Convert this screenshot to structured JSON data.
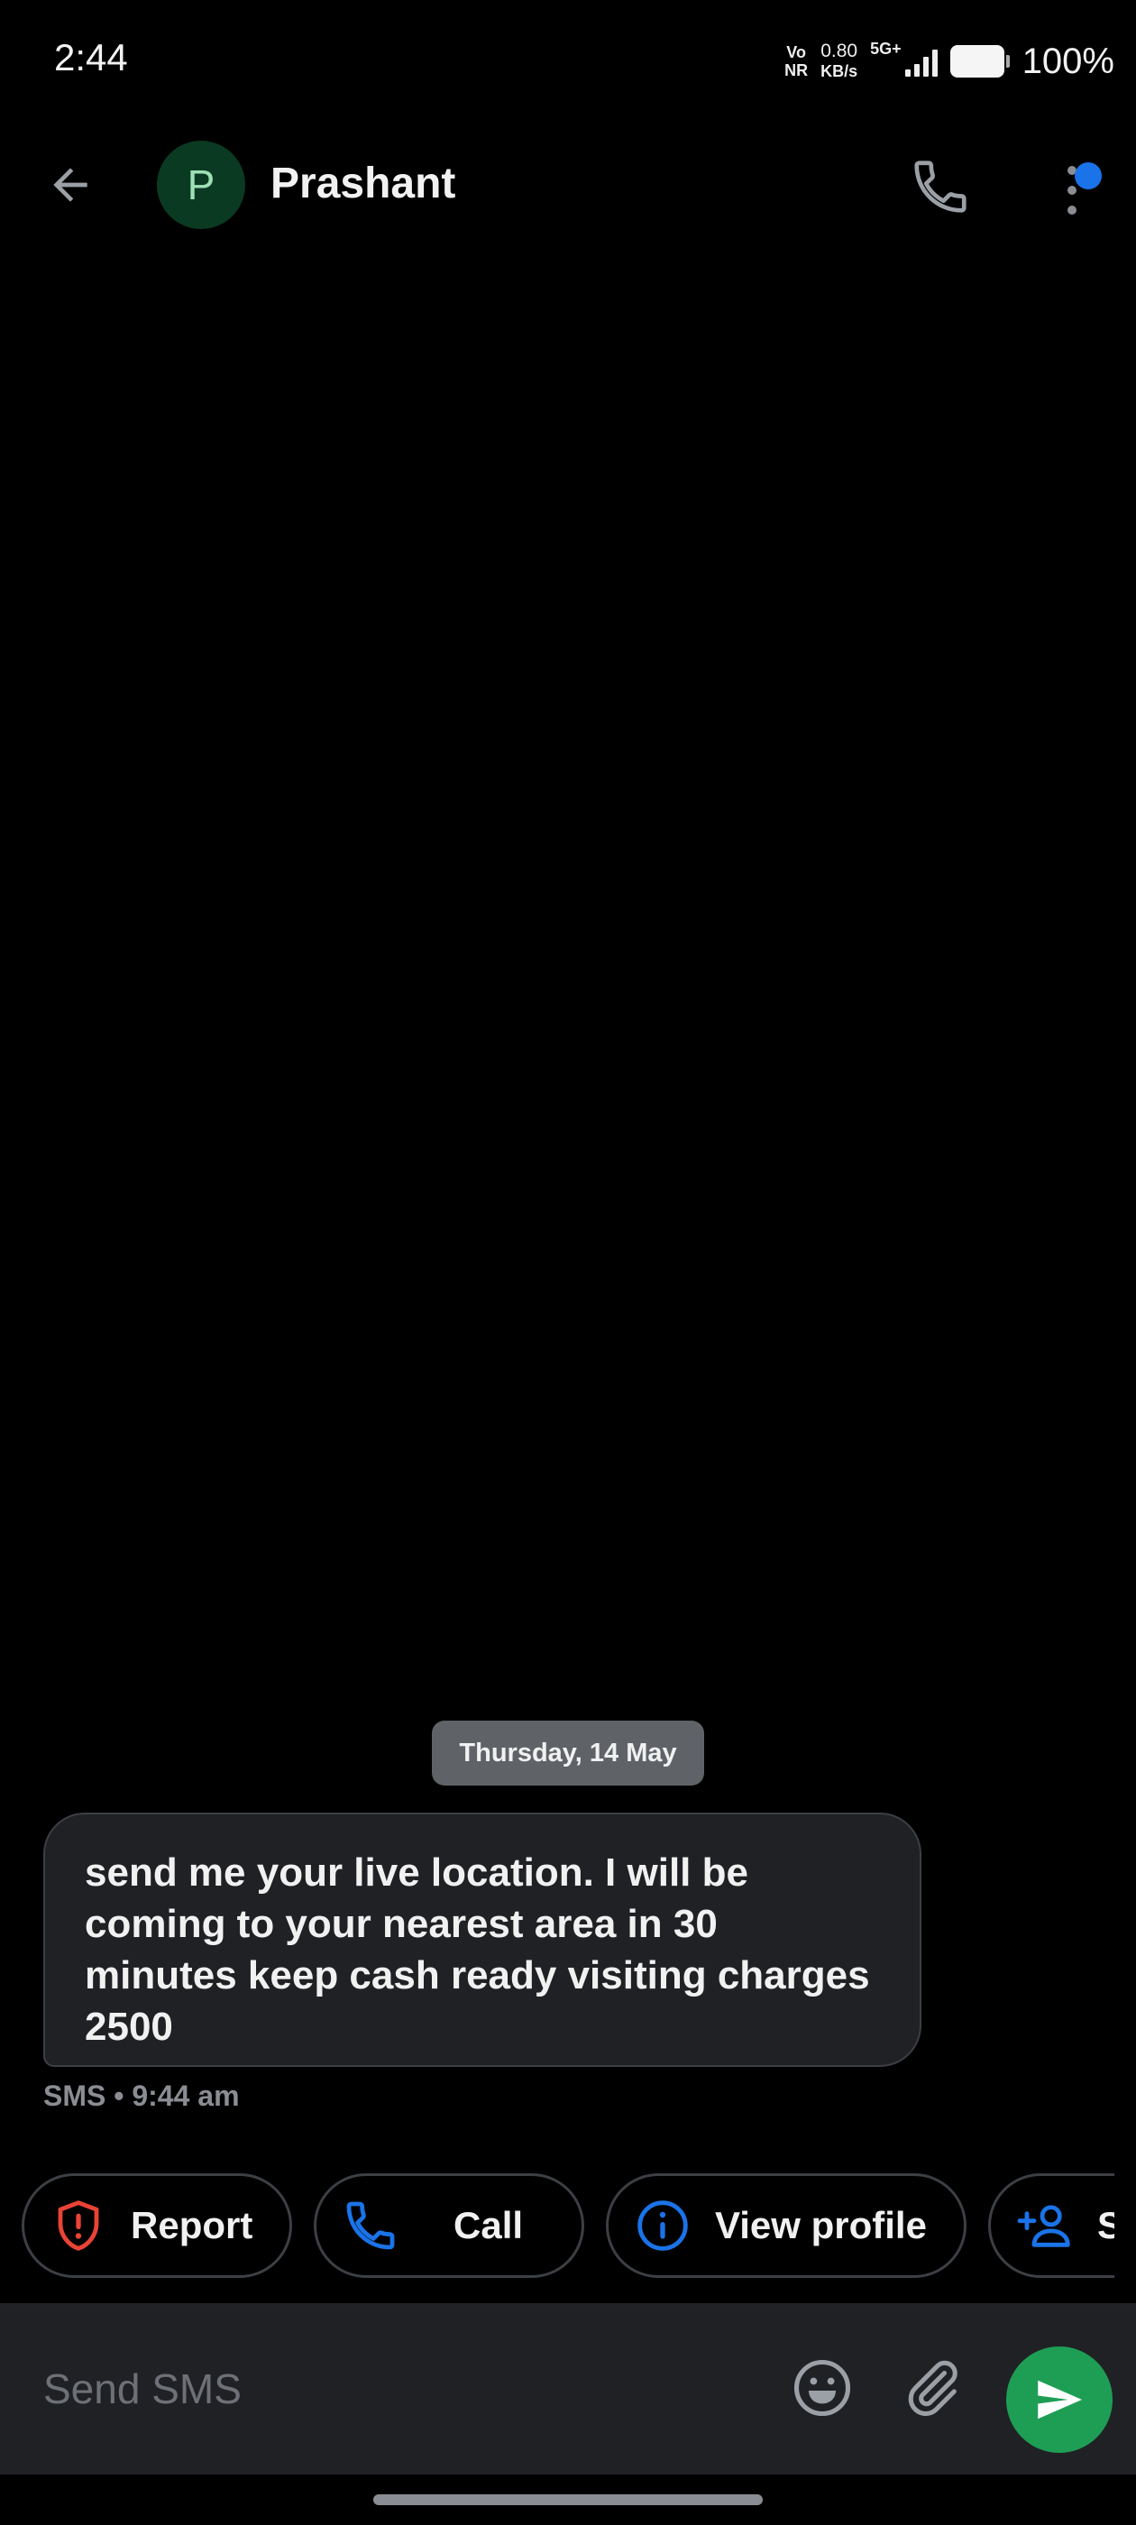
{
  "status_bar": {
    "time": "2:44",
    "volte_top": "Vo",
    "volte_bottom": "NR",
    "speed_value": "0.80",
    "speed_unit": "KB/s",
    "network": "5G+",
    "battery_percent": "100%"
  },
  "header": {
    "avatar_initial": "P",
    "contact_name": "Prashant"
  },
  "conversation": {
    "date_chip": "Thursday, 14 May",
    "message_text": "send me your live location. I will be coming to your nearest area in 30 minutes  keep cash ready visiting charges 2500",
    "message_meta": "SMS • 9:44 am"
  },
  "suggestions": [
    {
      "label": "Report",
      "icon": "shield-alert-icon",
      "color": "#ea4335"
    },
    {
      "label": "Call",
      "icon": "phone-icon",
      "color": "#1a73e8"
    },
    {
      "label": "View profile",
      "icon": "info-icon",
      "color": "#1a73e8"
    },
    {
      "label": "S",
      "icon": "add-person-icon",
      "color": "#1a73e8"
    }
  ],
  "composer": {
    "placeholder": "Send SMS"
  },
  "colors": {
    "background": "#000000",
    "bubble": "#202124",
    "send_button": "#1e9e55",
    "accent_blue": "#1a73e8",
    "report_red": "#ea4335"
  }
}
